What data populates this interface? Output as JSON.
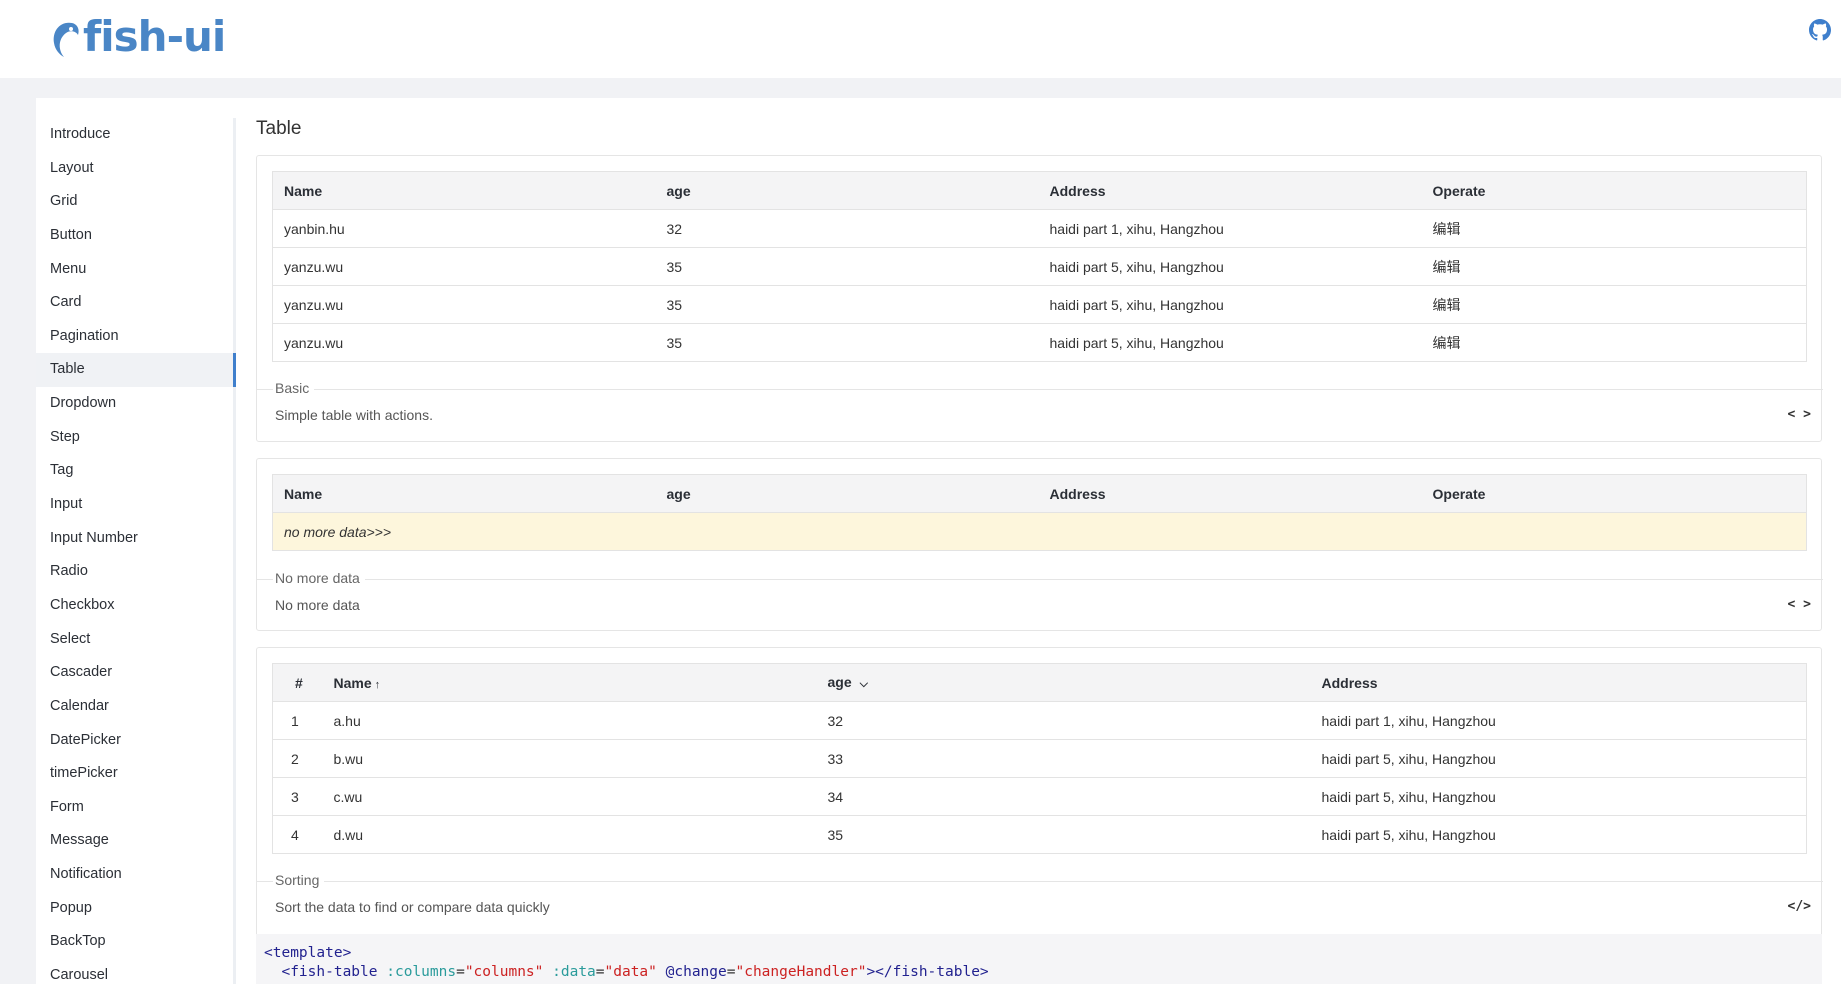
{
  "brand": {
    "name": "fish-ui"
  },
  "sidebar": {
    "items": [
      {
        "label": "Introduce"
      },
      {
        "label": "Layout"
      },
      {
        "label": "Grid"
      },
      {
        "label": "Button"
      },
      {
        "label": "Menu"
      },
      {
        "label": "Card"
      },
      {
        "label": "Pagination"
      },
      {
        "label": "Table",
        "active": true
      },
      {
        "label": "Dropdown"
      },
      {
        "label": "Step"
      },
      {
        "label": "Tag"
      },
      {
        "label": "Input"
      },
      {
        "label": "Input Number"
      },
      {
        "label": "Radio"
      },
      {
        "label": "Checkbox"
      },
      {
        "label": "Select"
      },
      {
        "label": "Cascader"
      },
      {
        "label": "Calendar"
      },
      {
        "label": "DatePicker"
      },
      {
        "label": "timePicker"
      },
      {
        "label": "Form"
      },
      {
        "label": "Message"
      },
      {
        "label": "Notification"
      },
      {
        "label": "Popup"
      },
      {
        "label": "BackTop"
      },
      {
        "label": "Carousel"
      }
    ]
  },
  "page": {
    "title": "Table"
  },
  "basic": {
    "columns": [
      "Name",
      "age",
      "Address",
      "Operate"
    ],
    "rows": [
      {
        "name": "yanbin.hu",
        "age": "32",
        "address": "haidi part 1, xihu, Hangzhou",
        "op": "编辑"
      },
      {
        "name": "yanzu.wu",
        "age": "35",
        "address": "haidi part 5, xihu, Hangzhou",
        "op": "编辑"
      },
      {
        "name": "yanzu.wu",
        "age": "35",
        "address": "haidi part 5, xihu, Hangzhou",
        "op": "编辑"
      },
      {
        "name": "yanzu.wu",
        "age": "35",
        "address": "haidi part 5, xihu, Hangzhou",
        "op": "编辑"
      }
    ],
    "meta_title": "Basic",
    "meta_desc": "Simple table with actions.",
    "code_toggle": "< >"
  },
  "empty": {
    "columns": [
      "Name",
      "age",
      "Address",
      "Operate"
    ],
    "no_data": "no more data>>>",
    "meta_title": "No more data",
    "meta_desc": "No more data",
    "code_toggle": "< >"
  },
  "sorting": {
    "columns": [
      "#",
      "Name",
      "age",
      "Address"
    ],
    "name_sort_icon": "↑",
    "age_sort_icon": "⌵",
    "rows": [
      {
        "idx": "1",
        "name": "a.hu",
        "age": "32",
        "address": "haidi part 1, xihu, Hangzhou"
      },
      {
        "idx": "2",
        "name": "b.wu",
        "age": "33",
        "address": "haidi part 5, xihu, Hangzhou"
      },
      {
        "idx": "3",
        "name": "c.wu",
        "age": "34",
        "address": "haidi part 5, xihu, Hangzhou"
      },
      {
        "idx": "4",
        "name": "d.wu",
        "age": "35",
        "address": "haidi part 5, xihu, Hangzhou"
      }
    ],
    "meta_title": "Sorting",
    "meta_desc": "Sort the data to find or compare data quickly",
    "code_toggle": "</>"
  },
  "code": {
    "open_tag": "<template>",
    "component_open": "<fish-table",
    "attr_columns": ":columns",
    "val_columns": "\"columns\"",
    "attr_data": ":data",
    "val_data": "\"data\"",
    "attr_change": "@change",
    "val_change": "\"changeHandler\"",
    "component_close": "></fish-table>"
  },
  "colors": {
    "accent": "#3f7fcc",
    "nodata_bg": "#fdf6dc",
    "brand": "#4a86c6"
  }
}
